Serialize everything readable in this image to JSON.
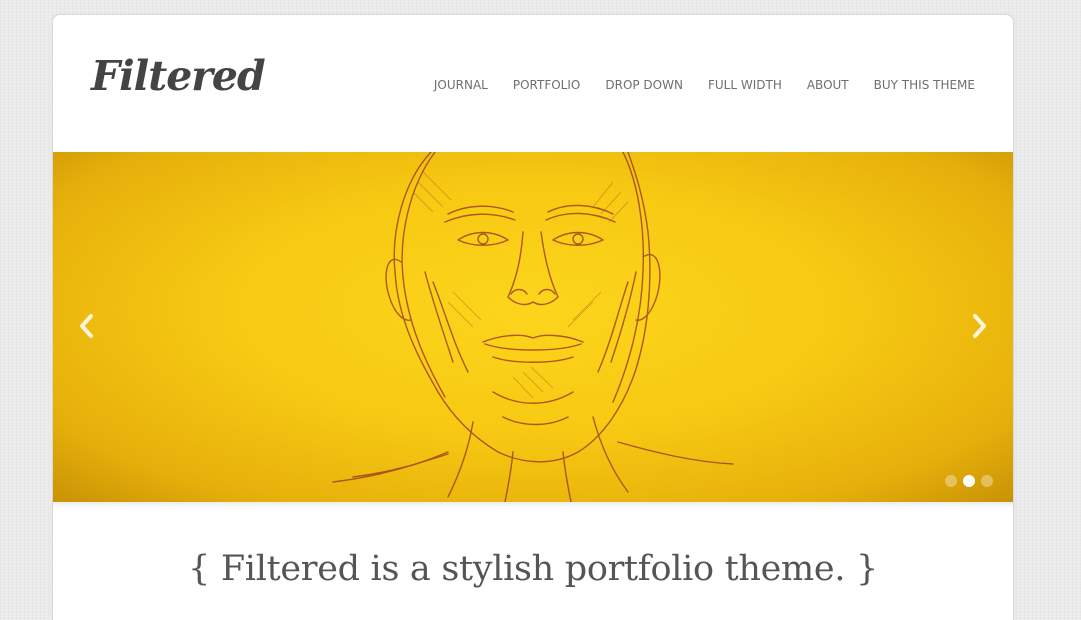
{
  "header": {
    "logo": "Filtered",
    "nav": [
      {
        "label": "JOURNAL"
      },
      {
        "label": "PORTFOLIO"
      },
      {
        "label": "DROP DOWN"
      },
      {
        "label": "FULL WIDTH"
      },
      {
        "label": "ABOUT"
      },
      {
        "label": "BUY THIS THEME"
      }
    ]
  },
  "slider": {
    "prev_icon": "chevron-left-icon",
    "next_icon": "chevron-right-icon",
    "slide_count": 3,
    "active_slide": 2,
    "colors": {
      "background": "#f7c913",
      "sketch": "#a0441c"
    }
  },
  "tagline": "{ Filtered is a stylish portfolio theme. }"
}
